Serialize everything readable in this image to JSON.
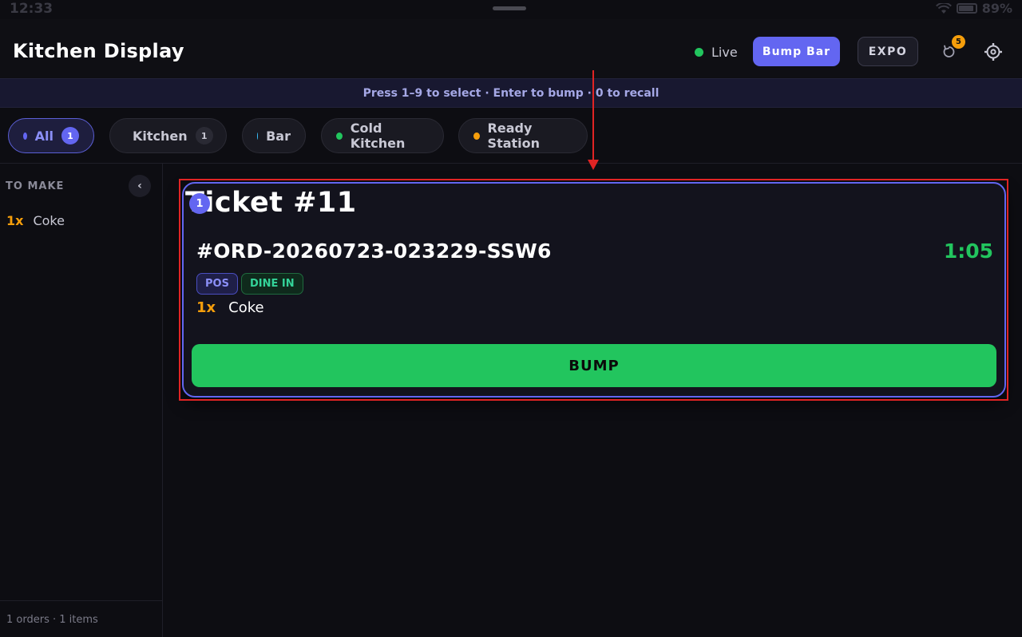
{
  "status_bar": {
    "time": "12:33",
    "battery": "89%"
  },
  "header": {
    "title": "Kitchen Display",
    "live_label": "Live",
    "bump_bar_label": "Bump Bar",
    "expo_label": "EXPO",
    "recall_count": "5",
    "recall_icon": "recall-icon",
    "settings_icon": "gear-icon"
  },
  "hint": "Press 1–9 to select · Enter to bump · 0 to recall",
  "filters": [
    {
      "label": "All",
      "count": "1",
      "color": "#6366f1"
    },
    {
      "label": "Kitchen",
      "count": "1",
      "color": "#ef4444"
    },
    {
      "label": "Bar",
      "count": "",
      "color": "#38bdf8"
    },
    {
      "label": "Cold Kitchen",
      "count": "",
      "color": "#22c55e"
    },
    {
      "label": "Ready Station",
      "count": "",
      "color": "#f59e0b"
    }
  ],
  "sidebar": {
    "title": "TO MAKE",
    "items": [
      {
        "qty": "1x",
        "name": "Coke"
      }
    ],
    "footer": "1 orders · 1 items"
  },
  "ticket": {
    "title": "Ticket #11",
    "badge": "1",
    "order_id": "#ORD-20260723-023229-SSW6",
    "timer": "1:05",
    "tags": [
      "POS",
      "DINE IN"
    ],
    "items": [
      {
        "qty": "1x",
        "name": "Coke"
      }
    ],
    "bump_label": "BUMP"
  },
  "colors": {
    "accent": "#6366f1",
    "success": "#22c55e",
    "warning": "#f59e0b",
    "annotation": "#e02424"
  }
}
